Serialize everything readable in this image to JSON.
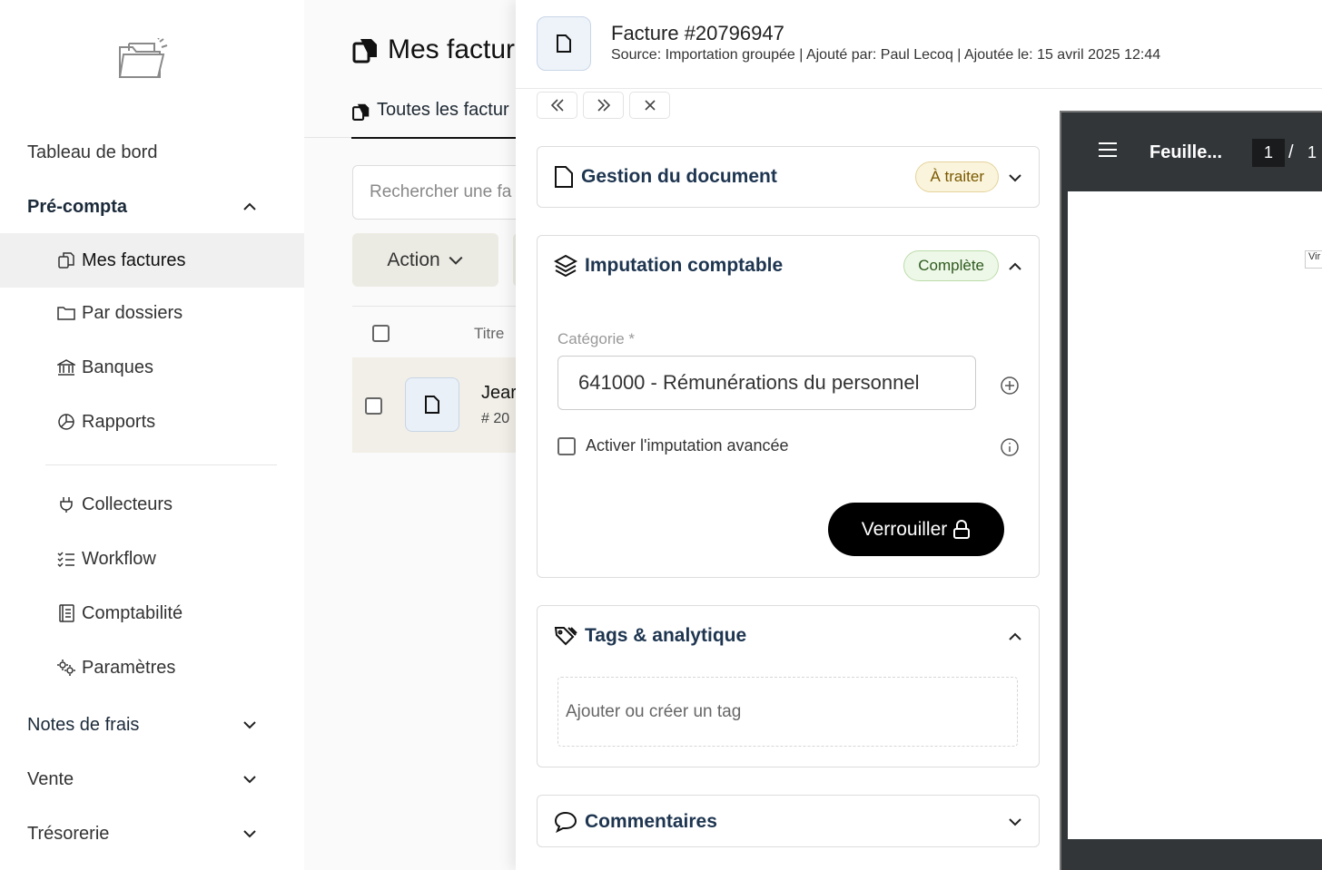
{
  "sidebar": {
    "items": [
      {
        "label": "Tableau de bord"
      },
      {
        "label": "Pré-compta"
      },
      {
        "label": "Mes factures"
      },
      {
        "label": "Par dossiers"
      },
      {
        "label": "Banques"
      },
      {
        "label": "Rapports"
      },
      {
        "label": "Collecteurs"
      },
      {
        "label": "Workflow"
      },
      {
        "label": "Comptabilité"
      },
      {
        "label": "Paramètres"
      },
      {
        "label": "Notes de frais"
      },
      {
        "label": "Vente"
      },
      {
        "label": "Trésorerie"
      }
    ]
  },
  "main": {
    "title": "Mes factur",
    "tab": "Toutes les factur",
    "search_placeholder": "Rechercher une fa",
    "action_label": "Action",
    "column_title": "Titre",
    "row": {
      "name": "Jear",
      "id": "# 20"
    }
  },
  "panel": {
    "title": "Facture #20796947",
    "meta": "Source:  Importation groupée | Ajouté par: Paul Lecoq | Ajoutée le: 15 avril 2025 12:44",
    "nav": {
      "prev": "«",
      "next": "»",
      "close": "×"
    },
    "doc_section": {
      "title": "Gestion du document",
      "badge": "À traiter"
    },
    "imputation": {
      "title": "Imputation comptable",
      "badge": "Complète",
      "category_label": "Catégorie *",
      "category_value": "641000 - Rémunérations du personnel",
      "advanced_label": "Activer l'imputation avancée",
      "lock_label": "Verrouiller"
    },
    "tags": {
      "title": "Tags & analytique",
      "placeholder": "Ajouter ou créer un tag"
    },
    "comments": {
      "title": "Commentaires"
    }
  },
  "pdf": {
    "name": "Feuille...",
    "page": "1",
    "sep": "/",
    "total": "1",
    "snippet": "Vir"
  },
  "colors": {
    "accent": "#1e3550",
    "warn_badge": "#fbf4dc",
    "ok_badge": "#eef8e8",
    "viewer": "#323639"
  }
}
